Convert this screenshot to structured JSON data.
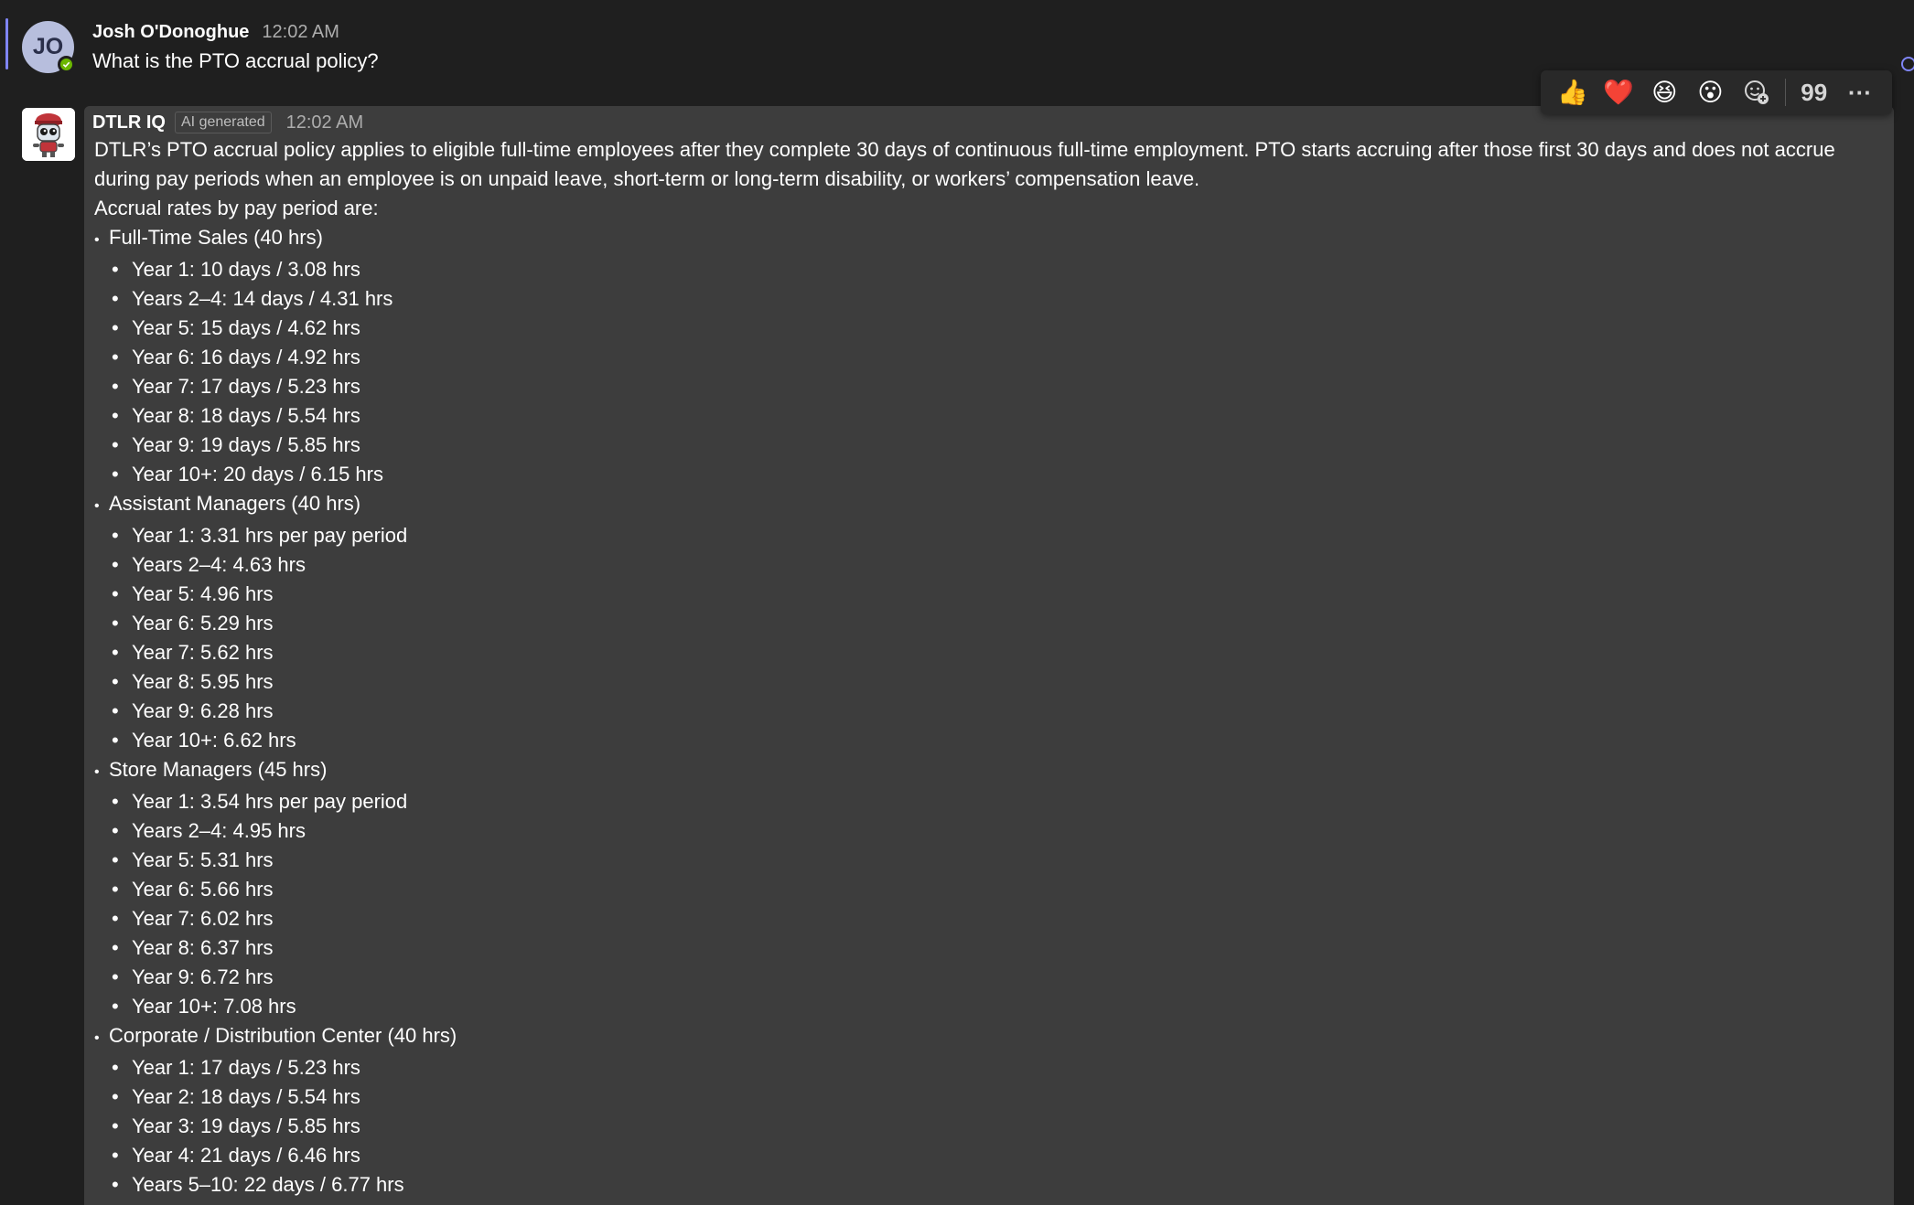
{
  "message1": {
    "avatar_initials": "JO",
    "author": "Josh O'Donoghue",
    "time": "12:02 AM",
    "text": "What is the PTO accrual policy?"
  },
  "message2": {
    "author": "DTLR IQ",
    "badge": "AI generated",
    "time": "12:02 AM",
    "intro": "DTLR’s PTO accrual policy applies to eligible full-time employees after they complete 30 days of continuous full-time employment. PTO starts accruing after those first 30 days and does not accrue during pay periods when an employee is on unpaid leave, short-term or long-term disability, or workers’ compensation leave.",
    "rates_heading": "Accrual rates by pay period are:",
    "categories": [
      {
        "title": "Full-Time Sales (40 hrs)",
        "items": [
          "Year 1: 10 days / 3.08 hrs",
          "Years 2–4: 14 days / 4.31 hrs",
          "Year 5: 15 days / 4.62 hrs",
          "Year 6: 16 days / 4.92 hrs",
          "Year 7: 17 days / 5.23 hrs",
          "Year 8: 18 days / 5.54 hrs",
          "Year 9: 19 days / 5.85 hrs",
          "Year 10+: 20 days / 6.15 hrs"
        ]
      },
      {
        "title": "Assistant Managers (40 hrs)",
        "items": [
          "Year 1: 3.31 hrs per pay period",
          "Years 2–4: 4.63 hrs",
          "Year 5: 4.96 hrs",
          "Year 6: 5.29 hrs",
          "Year 7: 5.62 hrs",
          "Year 8: 5.95 hrs",
          "Year 9: 6.28 hrs",
          "Year 10+: 6.62 hrs"
        ]
      },
      {
        "title": "Store Managers (45 hrs)",
        "items": [
          "Year 1: 3.54 hrs per pay period",
          "Years 2–4: 4.95 hrs",
          "Year 5: 5.31 hrs",
          "Year 6: 5.66 hrs",
          "Year 7: 6.02 hrs",
          "Year 8: 6.37 hrs",
          "Year 9: 6.72 hrs",
          "Year 10+: 7.08 hrs"
        ]
      },
      {
        "title": "Corporate / Distribution Center (40 hrs)",
        "items": [
          "Year 1: 17 days / 5.23 hrs",
          "Year 2: 18 days / 5.54 hrs",
          "Year 3: 19 days / 5.85 hrs",
          "Year 4: 21 days / 6.46 hrs",
          "Years 5–10: 22 days / 6.77 hrs"
        ]
      }
    ]
  },
  "toolbar": {
    "reactions": [
      {
        "icon": "thumbs-up-icon",
        "glyph": "👍"
      },
      {
        "icon": "heart-icon",
        "glyph": "❤️"
      },
      {
        "icon": "laugh-icon",
        "glyph": "😆"
      },
      {
        "icon": "surprised-icon",
        "glyph": "😮"
      }
    ],
    "quote_glyph": "99",
    "more_glyph": "···"
  },
  "colors": {
    "background": "#1f1f1f",
    "bubble": "#3d3d3d",
    "accent": "#7f85f5",
    "presence": "#6bb700"
  }
}
